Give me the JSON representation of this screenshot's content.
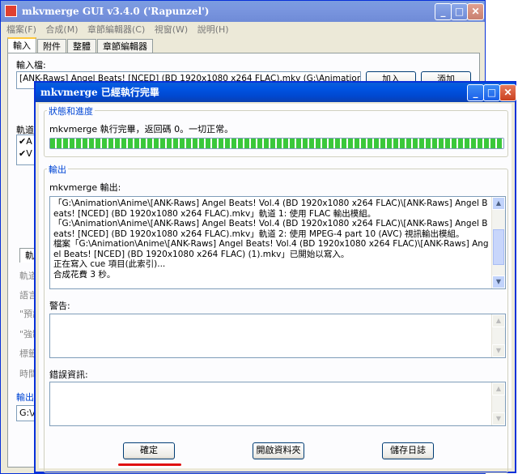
{
  "bg_window": {
    "title": "mkvmerge GUI v3.4.0 ('Rapunzel')",
    "menu": [
      "檔案(F)",
      "合成(M)",
      "章節編輯器(C)",
      "視窗(W)",
      "說明(H)"
    ],
    "tabs": [
      "輸入",
      "附件",
      "整體",
      "章節編輯器"
    ],
    "input_label": "輸入檔:",
    "input_file": "[ANK-Raws] Angel Beats! [NCED] (BD 1920x1080 x264 FLAC).mkv (G:\\Animation\\Anime\\[",
    "add_button": "加入",
    "append_button": "添加",
    "tracks_label": "軌道",
    "track_items": [
      "A",
      "V"
    ],
    "subtab_label": "軌道",
    "side_labels": [
      "軌道",
      "語言",
      "\"預設",
      "\"強制",
      "標籤",
      "時間"
    ],
    "output_label": "輸出檔",
    "output_value": "G:\\A"
  },
  "dialog": {
    "title": "mkvmerge 已經執行完畢",
    "status_group": "狀態和進度",
    "status_text": "mkvmerge 執行完畢，返回碼 0。一切正常。",
    "progress": 1.0,
    "output_group": "輸出",
    "output_label": "mkvmerge 輸出:",
    "output_log": "「G:\\Animation\\Anime\\[ANK-Raws] Angel Beats! Vol.4 (BD 1920x1080 x264 FLAC)\\[ANK-Raws] Angel Beats! [NCED] (BD 1920x1080 x264 FLAC).mkv」軌道 1: 使用 FLAC 輸出模組。\n「G:\\Animation\\Anime\\[ANK-Raws] Angel Beats! Vol.4 (BD 1920x1080 x264 FLAC)\\[ANK-Raws] Angel Beats! [NCED] (BD 1920x1080 x264 FLAC).mkv」軌道 2: 使用 MPEG-4 part 10 (AVC) 視訊輸出模組。\n檔案「G:\\Animation\\Anime\\[ANK-Raws] Angel Beats! Vol.4 (BD 1920x1080 x264 FLAC)\\[ANK-Raws] Angel Beats! [NCED] (BD 1920x1080 x264 FLAC) (1).mkv」已開始以寫入。\n正在寫入 cue 項目(此索引)...\n合成花費 3 秒。",
    "warnings_label": "警告:",
    "errors_label": "錯誤資訊:",
    "ok_button": "確定",
    "open_folder_button": "開啟資料夾",
    "save_log_button": "儲存日誌"
  },
  "colors": {
    "progress": "#3ac83a",
    "highlight_underline": "#e01010",
    "group_title": "#0046d5"
  }
}
